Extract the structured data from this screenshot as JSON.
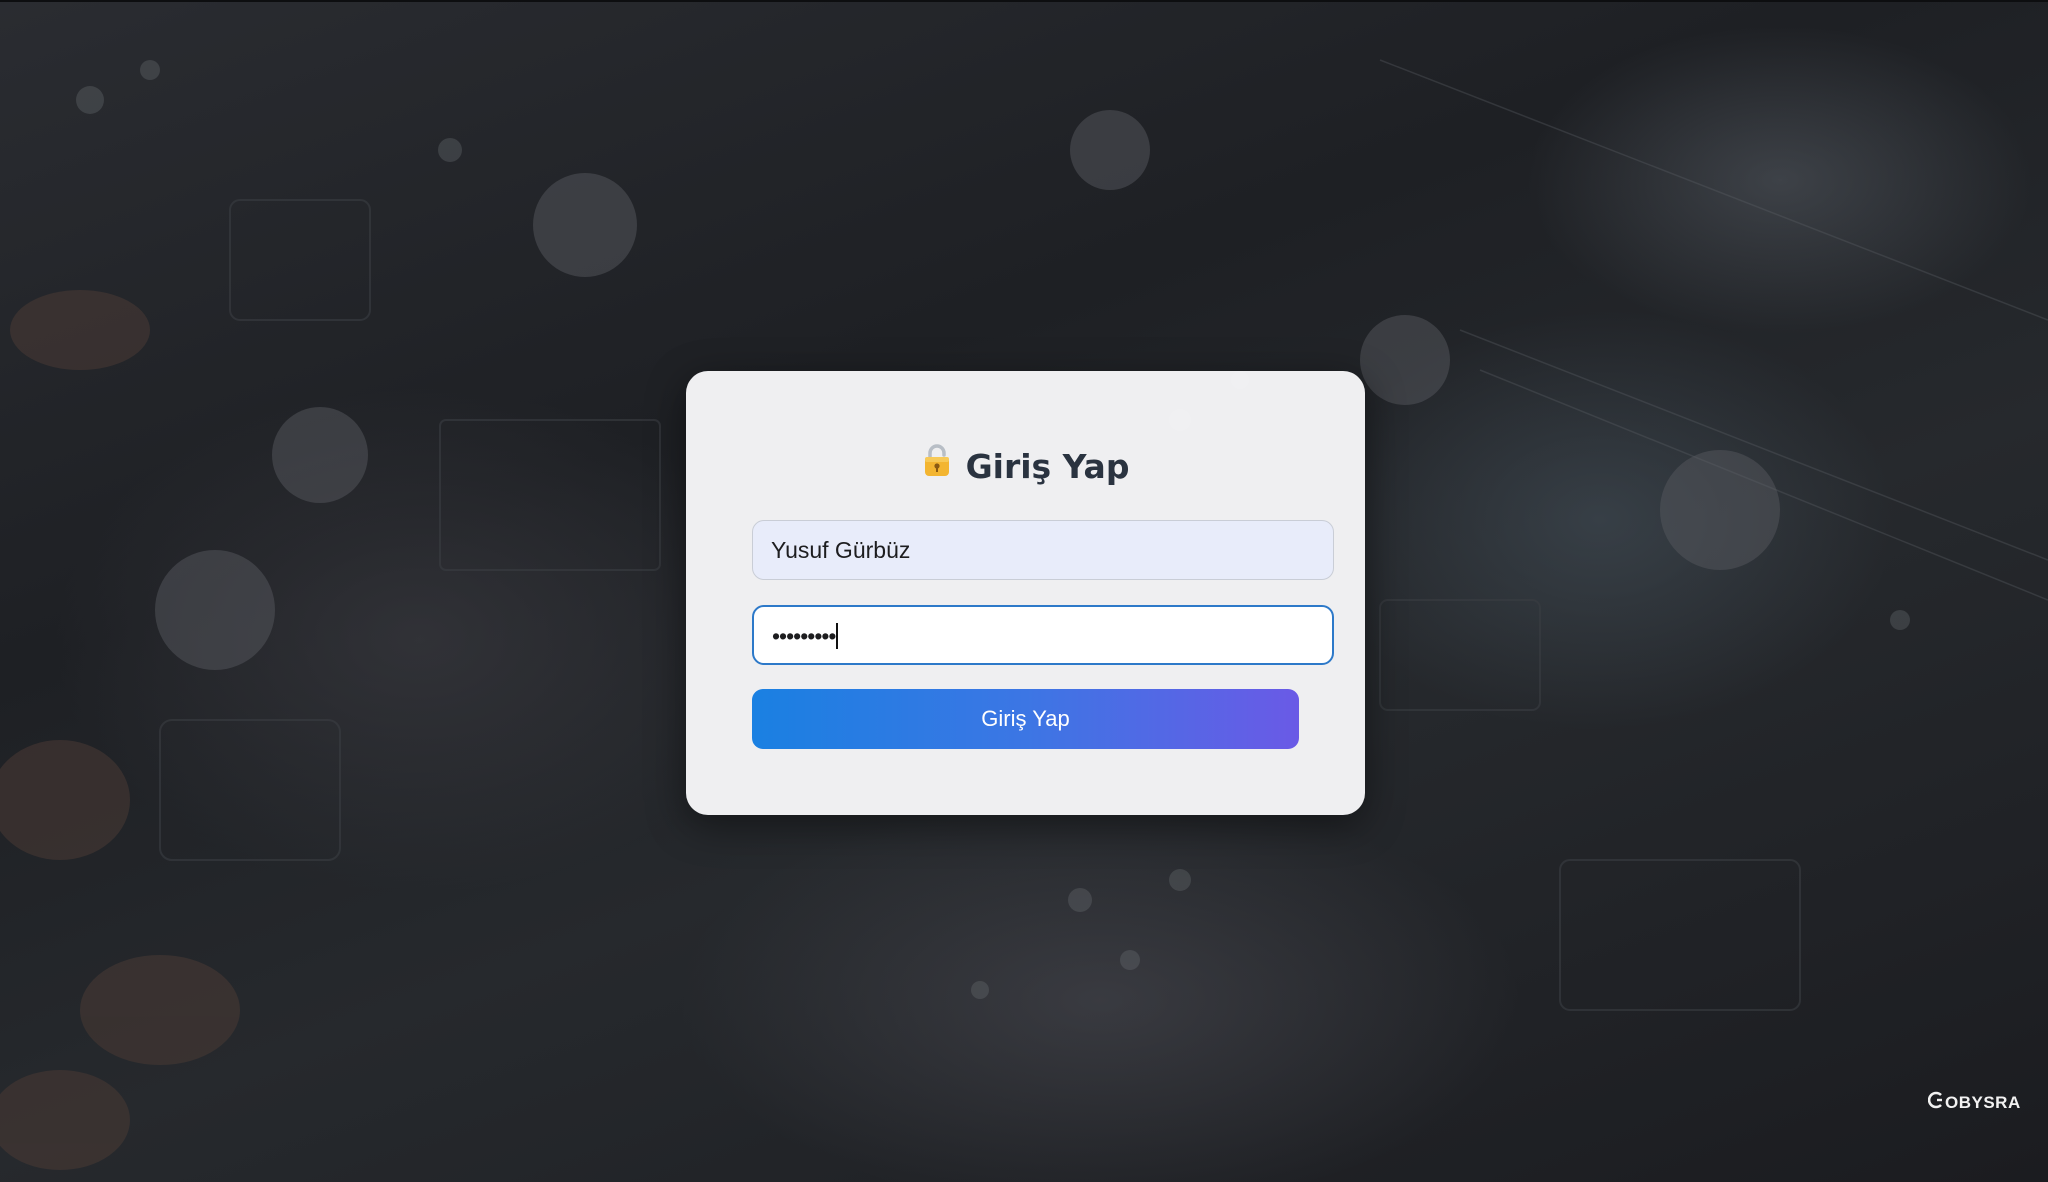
{
  "login": {
    "title": "Giriş Yap",
    "title_icon": "lock-icon",
    "username_value": "Yusuf Gürbüz",
    "password_masked": "•••••••••",
    "submit_label": "Giriş Yap"
  },
  "branding": {
    "logo_text": "OBYSRA",
    "logo_icon": "c-logo-mark"
  },
  "colors": {
    "card_background": "#f6f6f8",
    "username_fill": "#e8ecfa",
    "password_focus_border": "#2d79c9",
    "button_gradient_start": "#1a80e2",
    "button_gradient_end": "#6a5ae6",
    "title_text": "#2a3340"
  }
}
